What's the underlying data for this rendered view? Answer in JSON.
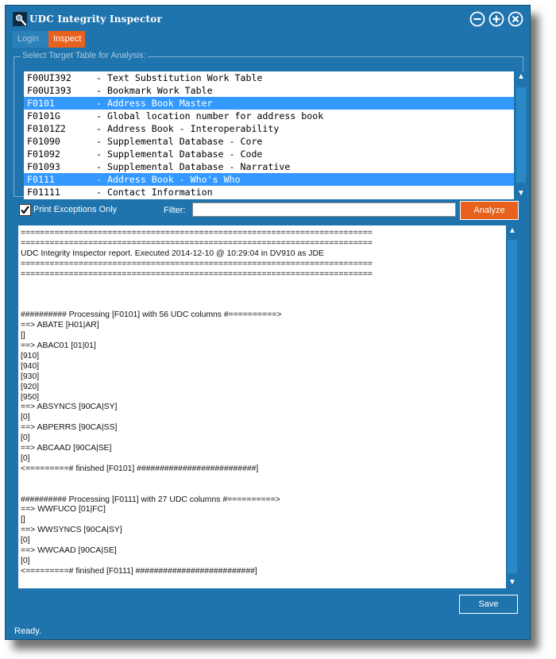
{
  "window": {
    "title": "UDC Integrity Inspector",
    "icon": "magnifier-app-icon",
    "controls": [
      "minimize-icon",
      "maximize-icon",
      "close-icon"
    ]
  },
  "tabs": [
    {
      "label": "Login",
      "active": false
    },
    {
      "label": "Inspect",
      "active": true
    }
  ],
  "table_group": {
    "label": "Select Target Table for Analysis:",
    "rows": [
      {
        "code": "F00UI392",
        "desc": "- Text Substitution Work Table",
        "selected": false
      },
      {
        "code": "F00UI393",
        "desc": "- Bookmark Work Table",
        "selected": false
      },
      {
        "code": "F0101",
        "desc": "- Address Book Master",
        "selected": true
      },
      {
        "code": "F0101G",
        "desc": "- Global location number for address book",
        "selected": false
      },
      {
        "code": "F0101Z2",
        "desc": "- Address Book - Interoperability",
        "selected": false
      },
      {
        "code": "F01090",
        "desc": "- Supplemental Database - Core",
        "selected": false
      },
      {
        "code": "F01092",
        "desc": "- Supplemental Database - Code",
        "selected": false
      },
      {
        "code": "F01093",
        "desc": "- Supplemental Database - Narrative",
        "selected": false
      },
      {
        "code": "F0111",
        "desc": "- Address Book - Who's Who",
        "selected": true
      },
      {
        "code": "F01111",
        "desc": "- Contact Information",
        "selected": false
      }
    ]
  },
  "options": {
    "print_exceptions_label": "Print Exceptions Only",
    "print_exceptions_checked": true,
    "filter_label": "Filter:",
    "filter_value": "",
    "analyze_label": "Analyze"
  },
  "report": {
    "lines": [
      "=========================================================================",
      "=========================================================================",
      "UDC Integrity Inspector report. Executed 2014-12-10 @ 10:29:04 in DV910 as JDE",
      "=========================================================================",
      "=========================================================================",
      "",
      "",
      "",
      "########## Processing [F0101] with 56 UDC columns #==========>",
      "==> ABATE [H01|AR]",
      "[]",
      "==> ABAC01 [01|01]",
      "[910]",
      "[940]",
      "[930]",
      "[920]",
      "[950]",
      "==> ABSYNCS [90CA|SY]",
      "[0]",
      "==> ABPERRS [90CA|SS]",
      "[0]",
      "==> ABCAAD [90CA|SE]",
      "[0]",
      "<=========# finished [F0101] ##########################]",
      "",
      "",
      "########## Processing [F0111] with 27 UDC columns #==========>",
      "==> WWFUCO [01|FC]",
      "[]",
      "==> WWSYNCS [90CA|SY]",
      "[0]",
      "==> WWCAAD [90CA|SE]",
      "[0]",
      "<=========# finished [F0111] ##########################]"
    ]
  },
  "save_label": "Save",
  "status": "Ready.",
  "colors": {
    "window_bg": "#1f74ad",
    "accent": "#e8611d",
    "selection": "#3399ff"
  }
}
